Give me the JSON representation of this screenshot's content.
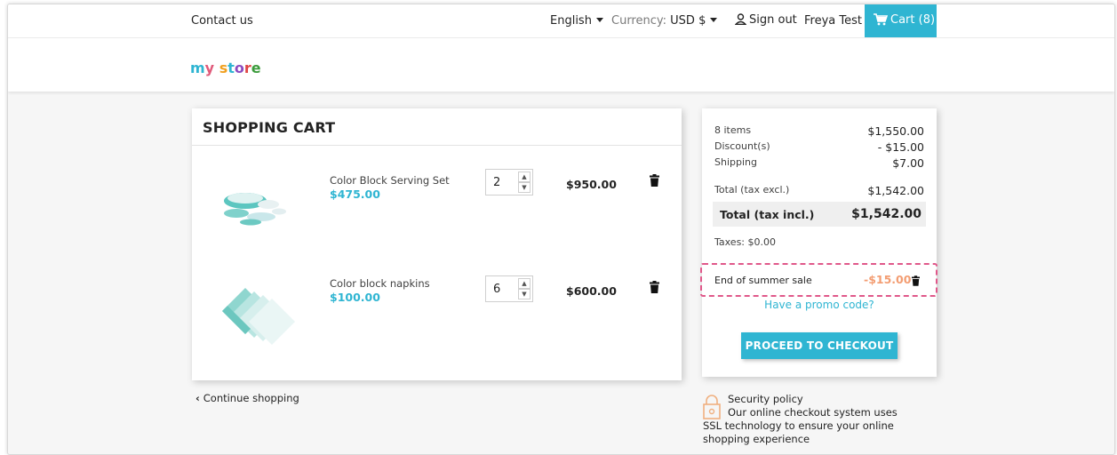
{
  "nav": {
    "contact": "Contact us",
    "language": "English",
    "currency_label": "Currency:",
    "currency_value": "USD $",
    "sign_out": "Sign out",
    "user": "Freya Test",
    "cart": "Cart (8)"
  },
  "logo": {
    "parts": [
      "m",
      "y",
      " ",
      "s",
      "t",
      "o",
      "r",
      "e"
    ]
  },
  "cart": {
    "title": "SHOPPING CART",
    "items": [
      {
        "name": "Color Block Serving Set",
        "unit_price": "$475.00",
        "quantity": "2",
        "total": "$950.00",
        "thumb": "serving-set"
      },
      {
        "name": "Color block napkins",
        "unit_price": "$100.00",
        "quantity": "6",
        "total": "$600.00",
        "thumb": "napkins"
      }
    ],
    "continue": "Continue shopping"
  },
  "summary": {
    "items_label": "8 items",
    "items_value": "$1,550.00",
    "discount_label": "Discount(s)",
    "discount_value": "- $15.00",
    "shipping_label": "Shipping",
    "shipping_value": "$7.00",
    "total_excl_label": "Total (tax excl.)",
    "total_excl_value": "$1,542.00",
    "total_incl_label": "Total (tax incl.)",
    "total_incl_value": "$1,542.00",
    "taxes": "Taxes: $0.00",
    "voucher_name": "End of summer sale",
    "voucher_amount": "-$15.00",
    "promo_link": "Have a promo code?",
    "checkout": "PROCEED TO CHECKOUT"
  },
  "security": {
    "title": "Security policy",
    "description": "Our online checkout system uses SSL technology to ensure your online shopping experience"
  },
  "colors": {
    "accent": "#2fb5d2",
    "voucher_border": "#e0588a",
    "voucher_amount": "#f39d72"
  }
}
